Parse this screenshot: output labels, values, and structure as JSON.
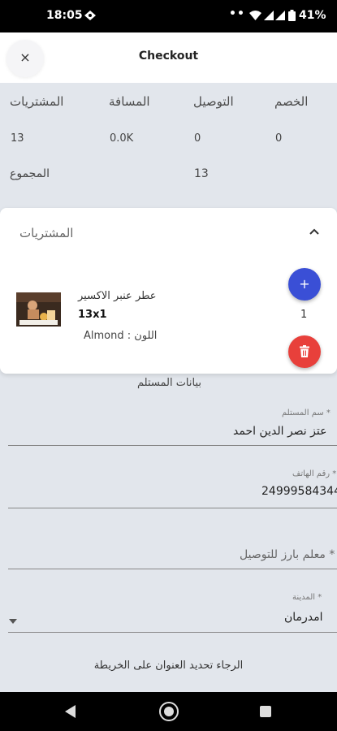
{
  "status_bar": {
    "time": "18:05",
    "dots": "••",
    "battery": "41%",
    "icons": [
      "cast-icon",
      "wifi-icon",
      "signal-icon",
      "signal-icon",
      "battery-icon"
    ]
  },
  "header": {
    "close_label": "×",
    "title": "Checkout"
  },
  "summary": {
    "headers": {
      "purchases": "المشتريات",
      "distance": "المسافة",
      "delivery": "التوصيل",
      "discount": "الخصم"
    },
    "values": {
      "purchases": "13",
      "distance": "0.0K",
      "delivery": "0",
      "discount": "0"
    },
    "total_label": "المجموع",
    "total_value": "13"
  },
  "products": {
    "title": "المشتريات",
    "items": [
      {
        "name": "عطر عنبر الاكسير",
        "qty": "13x1",
        "color": "Almond : اللون",
        "count": "1"
      }
    ],
    "add_label": "+"
  },
  "recipient": {
    "section_title": "بيانات المستلم",
    "name_label": "سم المستلم *",
    "name_value": "عتز نصر الدين احمد",
    "phone_label": "رقم الهاتف *",
    "phone_value": "24999584344",
    "landmark_placeholder": "معلم بارز للتوصيل *",
    "city_label": "المدينة *",
    "city_value": "امدرمان",
    "map_note": "الرجاء تحديد العنوان على الخريطة"
  },
  "colors": {
    "accent_blue": "#3a4fd6",
    "danger_red": "#e8403b",
    "background": "#e2e6ec"
  }
}
